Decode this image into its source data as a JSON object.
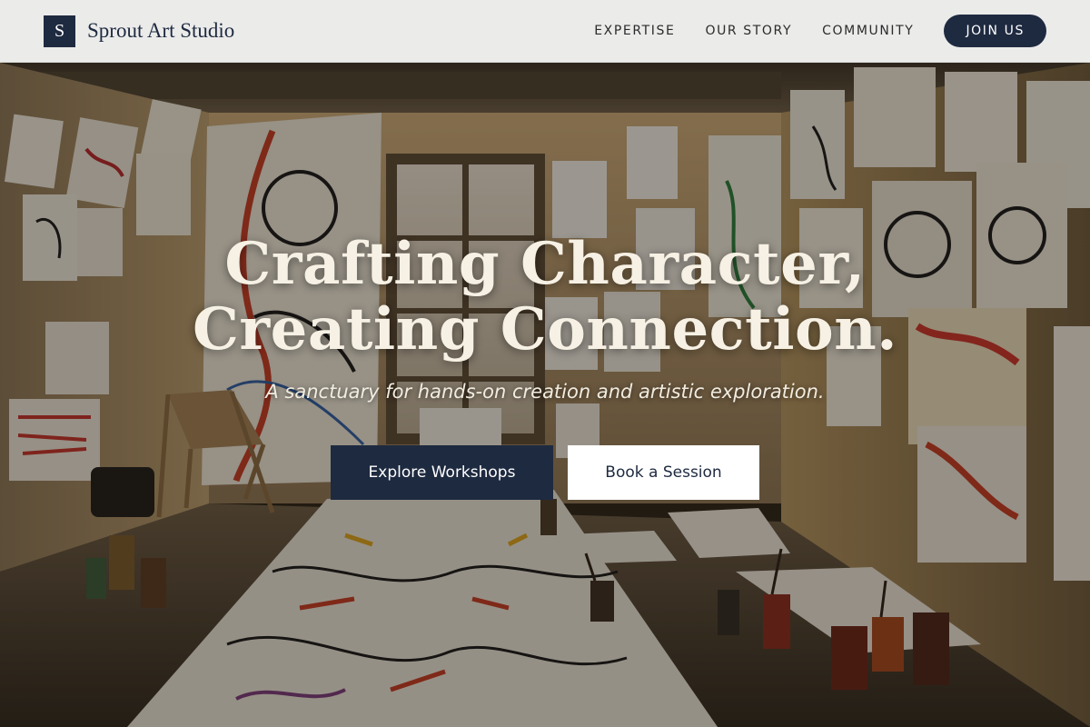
{
  "header": {
    "logo_letter": "S",
    "brand_name": "Sprout Art Studio",
    "nav": [
      {
        "label": "EXPERTISE"
      },
      {
        "label": "OUR STORY"
      },
      {
        "label": "COMMUNITY"
      }
    ],
    "join_label": "JOIN US"
  },
  "hero": {
    "headline_line1": "Crafting Character,",
    "headline_line2": "Creating Connection.",
    "subtitle": "A sanctuary for hands-on creation and artistic exploration.",
    "primary_cta": "Explore Workshops",
    "secondary_cta": "Book a Session",
    "background_image": "art-studio-photo"
  },
  "colors": {
    "brand_navy": "#1e2a40",
    "header_bg": "#ebebea",
    "headline_cream": "#f6f1e4"
  }
}
